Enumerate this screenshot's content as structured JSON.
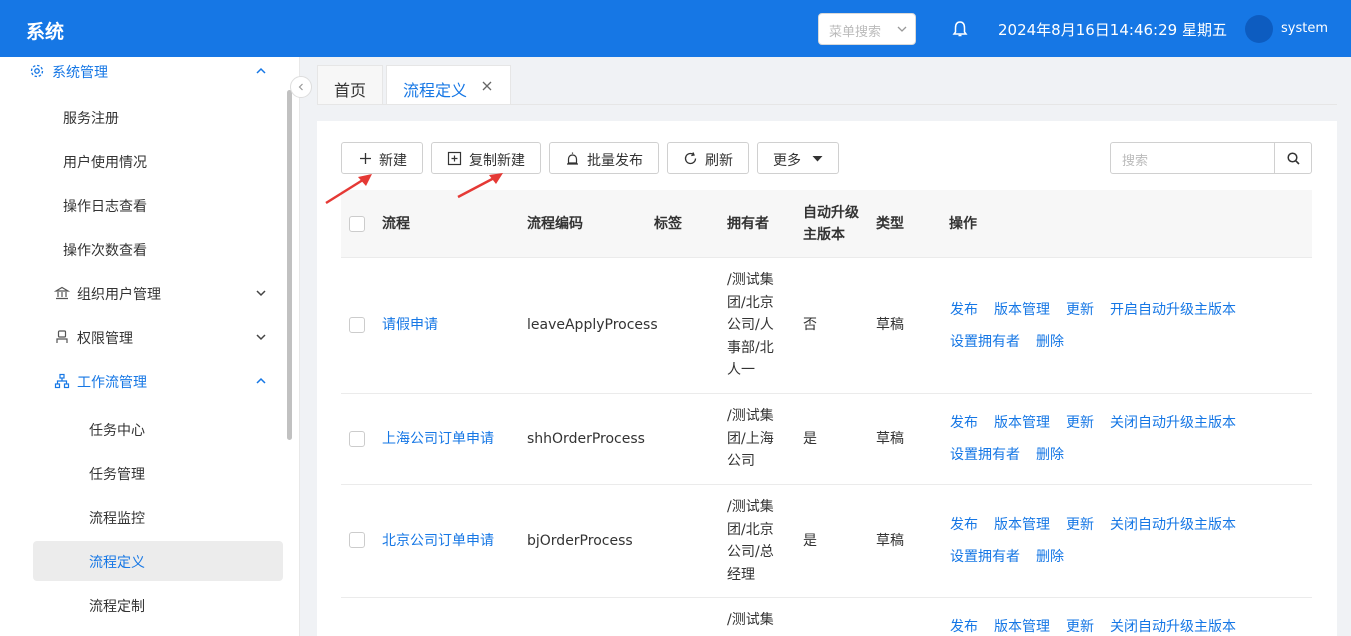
{
  "header": {
    "title": "系统",
    "menu_search_placeholder": "菜单搜索",
    "datetime": "2024年8月16日14:46:29 星期五",
    "username": "system",
    "colors": {
      "primary": "#1677e5"
    }
  },
  "sidebar": {
    "items": [
      {
        "label": "系统管理",
        "icon": "gear-icon"
      },
      {
        "label": "服务注册"
      },
      {
        "label": "用户使用情况"
      },
      {
        "label": "操作日志查看"
      },
      {
        "label": "操作次数查看"
      },
      {
        "label": "组织用户管理",
        "icon": "bank-icon"
      },
      {
        "label": "权限管理",
        "icon": "user-permission-icon"
      },
      {
        "label": "工作流管理",
        "icon": "workflow-icon"
      },
      {
        "label": "任务中心"
      },
      {
        "label": "任务管理"
      },
      {
        "label": "流程监控"
      },
      {
        "label": "流程定义"
      },
      {
        "label": "流程定制"
      }
    ]
  },
  "tabs": [
    {
      "label": "首页"
    },
    {
      "label": "流程定义"
    }
  ],
  "toolbar": {
    "new": "新建",
    "copy_new": "复制新建",
    "batch_publish": "批量发布",
    "refresh": "刷新",
    "more": "更多",
    "search_placeholder": "搜索"
  },
  "table": {
    "columns": [
      "流程",
      "流程编码",
      "标签",
      "拥有者",
      "自动升级主版本",
      "类型",
      "操作"
    ],
    "rows": [
      {
        "name": "请假申请",
        "code": "leaveApplyProcess",
        "tag": "",
        "owner": "/测试集团/北京公司/人事部/北人一",
        "auto": "否",
        "type": "草稿",
        "ops1": [
          "发布",
          "版本管理",
          "更新",
          "开启自动升级主版本"
        ],
        "ops2": [
          "设置拥有者",
          "删除"
        ]
      },
      {
        "name": "上海公司订单申请",
        "code": "shhOrderProcess",
        "tag": "",
        "owner": "/测试集团/上海公司",
        "auto": "是",
        "type": "草稿",
        "ops1": [
          "发布",
          "版本管理",
          "更新",
          "关闭自动升级主版本"
        ],
        "ops2": [
          "设置拥有者",
          "删除"
        ]
      },
      {
        "name": "北京公司订单申请",
        "code": "bjOrderProcess",
        "tag": "",
        "owner": "/测试集团/北京公司/总经理",
        "auto": "是",
        "type": "草稿",
        "ops1": [
          "发布",
          "版本管理",
          "更新",
          "关闭自动升级主版本"
        ],
        "ops2": [
          "设置拥有者",
          "删除"
        ]
      },
      {
        "name": "",
        "code": "",
        "tag": "",
        "owner": "/测试集",
        "auto": "",
        "type": "",
        "ops1": [
          "发布",
          "版本管理",
          "更新",
          "关闭自动升级主版本"
        ],
        "ops2": []
      }
    ]
  }
}
